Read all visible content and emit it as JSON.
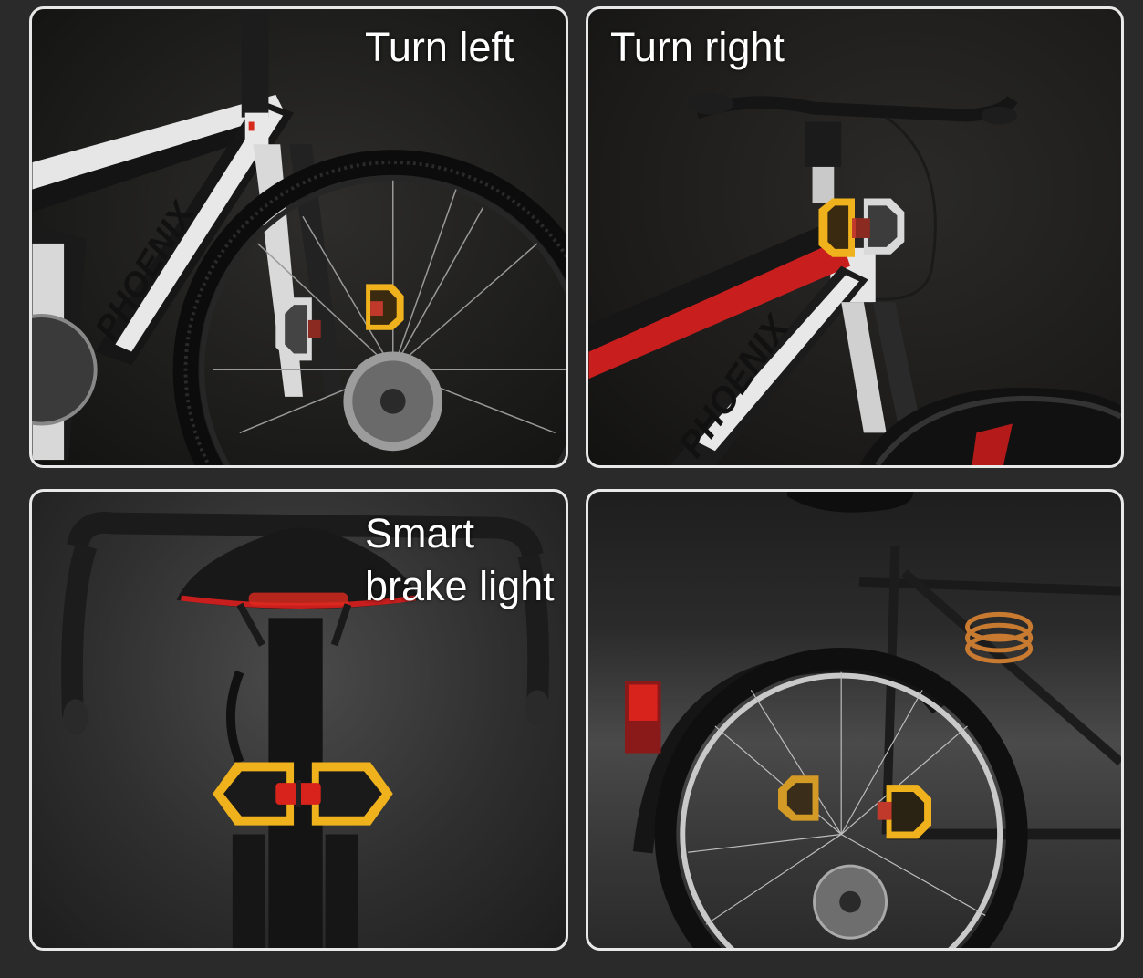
{
  "panels": [
    {
      "label": "Turn left"
    },
    {
      "label": "Turn right"
    },
    {
      "label": "Smart\nbrake light"
    },
    {
      "label": ""
    }
  ],
  "brand_text": [
    "PHOENIX",
    "PHOENIX"
  ],
  "colors": {
    "indicator_amber": "#f0b21c",
    "indicator_white": "#d9d9d9",
    "brake_red": "#d8231c",
    "frame_red": "#c81e1e",
    "frame_white": "#e6e6e6",
    "frame_black": "#161616"
  }
}
